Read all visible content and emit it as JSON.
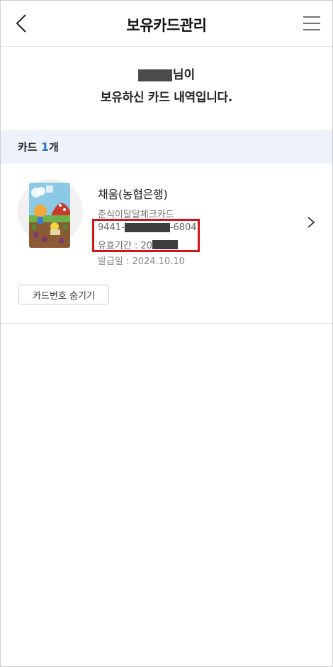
{
  "header": {
    "title": "보유카드관리",
    "back_icon": "chevron-left-icon",
    "menu_icon": "hamburger-menu-icon"
  },
  "greeting": {
    "name_suffix": "님이",
    "message": "보유하신 카드 내역입니다."
  },
  "section": {
    "label": "카드",
    "count": "1",
    "unit": "개",
    "accent_color": "#2f6fd0"
  },
  "card": {
    "name": "채움(농협은행)",
    "product": "춘식이달달체크카드",
    "number_prefix": "9441-",
    "number_suffix": "-6804",
    "expiry_label": "유효기간 : 20",
    "issue_date": "발급일 : 2024.10.10",
    "highlight_color": "#d0161b",
    "chevron_icon": "chevron-right-icon"
  },
  "actions": {
    "hide_button": "카드번호 숨기기"
  }
}
